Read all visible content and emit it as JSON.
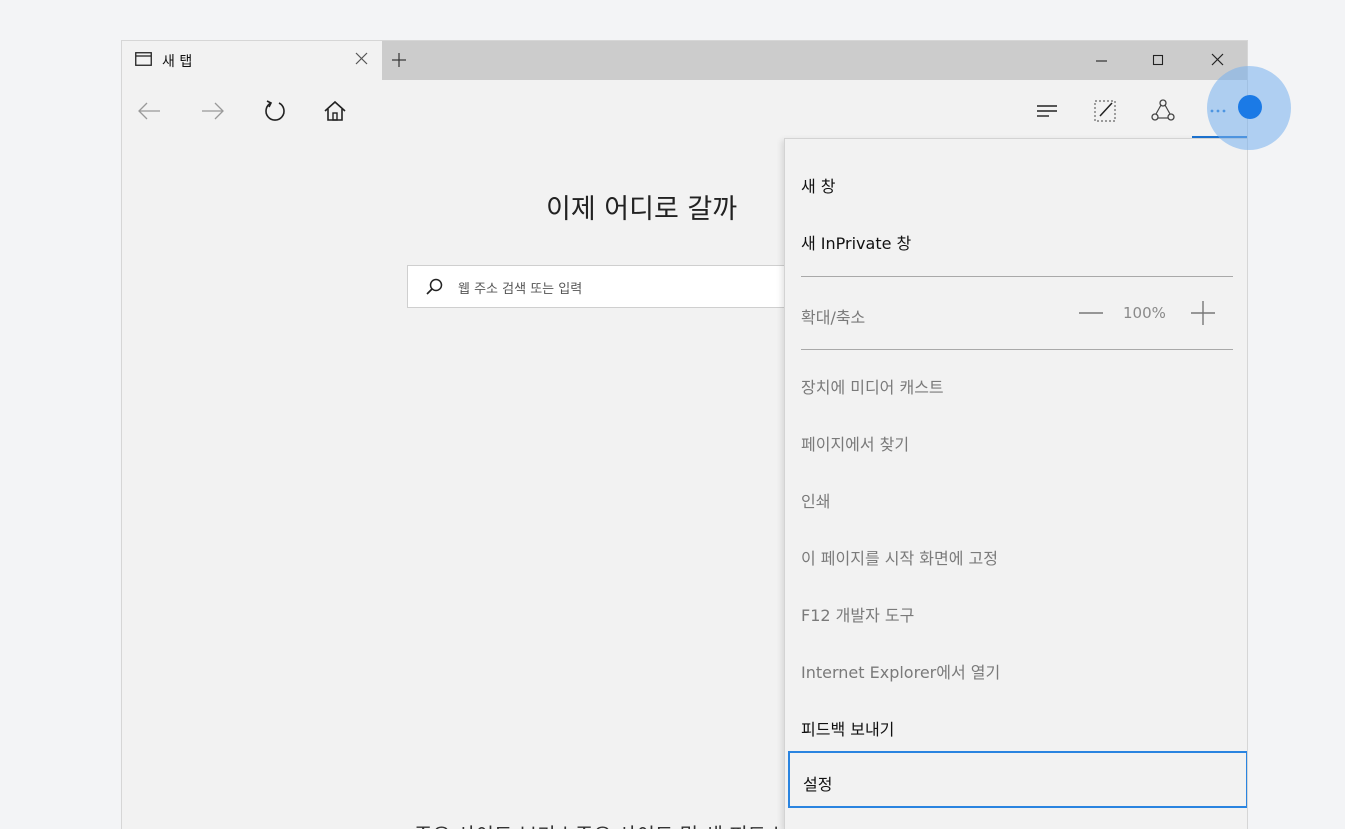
{
  "tab": {
    "title": "새 탭"
  },
  "page": {
    "heading": "이제 어디로 갈까",
    "search_placeholder": "웹 주소 검색 또는 입력",
    "bottom_links": "주요 사이트 보기 | 주요 사이트 및 새 피드 보기"
  },
  "menu": {
    "new_window": "새 창",
    "new_inprivate": "새 InPrivate 창",
    "zoom_label": "확대/축소",
    "zoom_value": "100%",
    "cast": "장치에 미디어 캐스트",
    "find": "페이지에서 찾기",
    "print": "인쇄",
    "pin": "이 페이지를 시작 화면에 고정",
    "devtools": "F12 개발자 도구",
    "open_ie": "Internet Explorer에서 열기",
    "feedback": "피드백 보내기",
    "settings": "설정"
  },
  "colors": {
    "accent": "#1c73d1",
    "focus_border": "#2a84e0",
    "tap_dot": "#1b7ae6"
  },
  "icons": {
    "tab": "tab-page-icon",
    "back": "back-arrow-icon",
    "forward": "forward-arrow-icon",
    "refresh": "refresh-icon",
    "home": "home-icon",
    "hub": "hub-icon",
    "note": "web-note-icon",
    "share": "share-icon",
    "more": "more-dots-icon",
    "search": "search-icon"
  }
}
